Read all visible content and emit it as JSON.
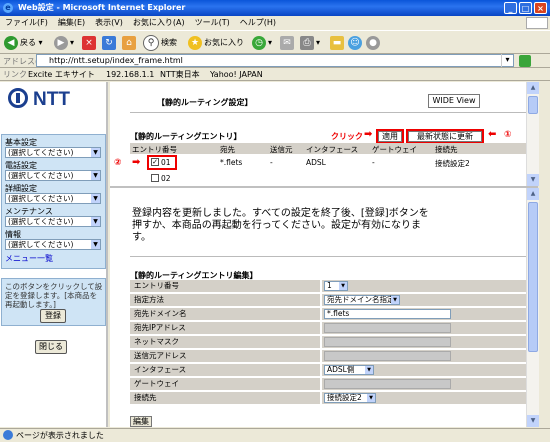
{
  "window": {
    "title": "Web設定 - Microsoft Internet Explorer"
  },
  "menubar": [
    "ファイル(F)",
    "編集(E)",
    "表示(V)",
    "お気に入り(A)",
    "ツール(T)",
    "ヘルプ(H)"
  ],
  "toolbar": {
    "back": "戻る",
    "search": "検索",
    "favorites": "お気に入り"
  },
  "address": {
    "label": "アドレス(D)",
    "url": "http://ntt.setup/index_frame.html"
  },
  "links": {
    "label": "リンク",
    "items": [
      "Excite エキサイト",
      "192.168.1.1",
      "NTT東日本",
      "Yahoo! JAPAN"
    ]
  },
  "left": {
    "logo": "NTT",
    "nav": [
      {
        "label": "基本設定",
        "select": "(選択してください)"
      },
      {
        "label": "電話設定",
        "select": "(選択してください)"
      },
      {
        "label": "詳細設定",
        "select": "(選択してください)"
      },
      {
        "label": "メンテナンス",
        "select": "(選択してください)"
      },
      {
        "label": "情報",
        "select": "(選択してください)"
      }
    ],
    "menu_list": "メニュー一覧",
    "info": "このボタンをクリックして設定を登録します。[本商品を再起動します。]",
    "register_button": "登録",
    "close_button": "閉じる"
  },
  "top": {
    "title": "【静的ルーティング設定】",
    "wide_view": "WIDE View",
    "entries_title": "【静的ルーティングエントリ】",
    "click_label": "クリック",
    "apply_button": "適用",
    "refresh_button": "最新状態に更新",
    "marker1": "①",
    "marker2": "②",
    "columns": [
      "エントリ番号",
      "宛先",
      "送信元",
      "インタフェース",
      "ゲートウェイ",
      "接続先"
    ],
    "rows": [
      {
        "id": "01",
        "dest": "*.flets",
        "src": "-",
        "iface": "ADSL",
        "gw": "-",
        "conn": "接続設定2",
        "checked": true
      },
      {
        "id": "02",
        "dest": "",
        "src": "",
        "iface": "",
        "gw": "",
        "conn": "",
        "checked": false
      }
    ]
  },
  "bottom": {
    "message": "登録内容を更新しました。すべての設定を終了後、[登録]ボタンを押すか、本商品の再起動を行ってください。設定が有効になります。",
    "edit_title": "【静的ルーティングエントリ編集】",
    "fields": [
      {
        "label": "エントリ番号",
        "value": "1"
      },
      {
        "label": "指定方法",
        "value": "宛先ドメイン名指定"
      },
      {
        "label": "宛先ドメイン名",
        "value": "*.flets"
      },
      {
        "label": "宛先IPアドレス",
        "value": ""
      },
      {
        "label": "ネットマスク",
        "value": ""
      },
      {
        "label": "送信元アドレス",
        "value": ""
      },
      {
        "label": "インタフェース",
        "value": "ADSL側"
      },
      {
        "label": "ゲートウェイ",
        "value": ""
      },
      {
        "label": "接続先",
        "value": "接続設定2"
      }
    ],
    "edit_button": "編集"
  },
  "status": {
    "text": "ページが表示されました"
  },
  "colors": {
    "accent_red": "#e00000",
    "nav_bg": "#cfe4f5",
    "titlebar": "#0a55d9"
  }
}
